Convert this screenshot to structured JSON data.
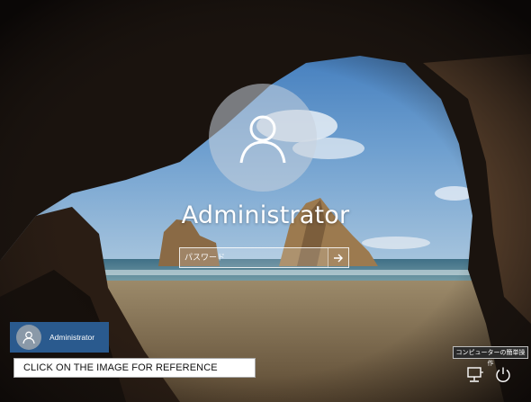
{
  "login": {
    "user_name": "Administrator",
    "password_placeholder": "パスワード",
    "password_value": ""
  },
  "user_list": [
    {
      "name": "Administrator",
      "selected": true
    }
  ],
  "reference_banner": "CLICK ON THE IMAGE FOR REFERENCE",
  "ease_of_access_tooltip": "コンピューターの簡単操作",
  "bottom_icons": [
    {
      "icon": "network-icon"
    },
    {
      "icon": "power-icon"
    }
  ],
  "colors": {
    "selected_user_tile": "#2a5a8e",
    "banner_background": "#ffffff",
    "tooltip_background": "#2b2b2b",
    "text_primary": "#ffffff"
  }
}
